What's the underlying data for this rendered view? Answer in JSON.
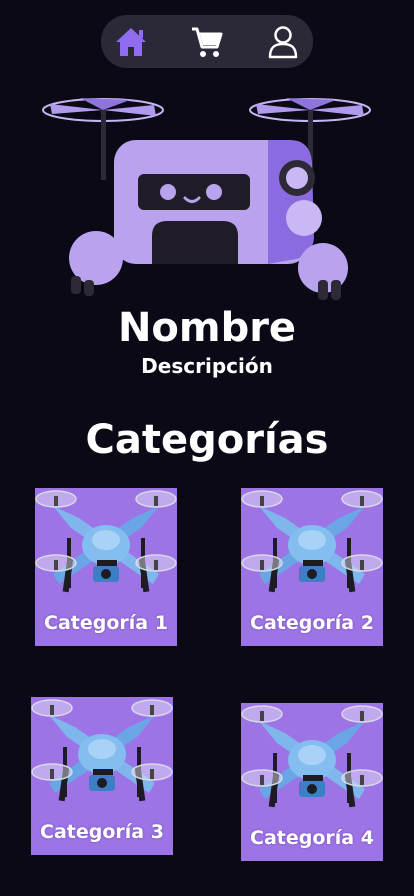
{
  "nav": {
    "items": [
      {
        "icon": "home-icon",
        "active": true
      },
      {
        "icon": "cart-icon",
        "active": false
      },
      {
        "icon": "user-icon",
        "active": false
      }
    ],
    "active_color": "#8f6cf0",
    "inactive_color": "#ffffff"
  },
  "profile": {
    "name": "Nombre",
    "description": "Descripción"
  },
  "categories_section": {
    "title": "Categorías",
    "items": [
      {
        "label": "Categoría 1"
      },
      {
        "label": "Categoría 2"
      },
      {
        "label": "Categoría 3"
      },
      {
        "label": "Categoría 4"
      }
    ]
  },
  "colors": {
    "background": "#0b0916",
    "navbar": "#2b2838",
    "card": "#9d74e6",
    "robot": "#b9a3ee"
  }
}
